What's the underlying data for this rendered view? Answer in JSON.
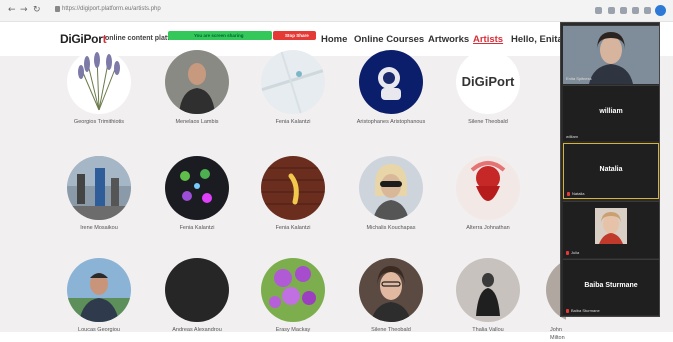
{
  "browser": {
    "url": "https://digiport.platform.eu/artists.php",
    "back_glyph": "←",
    "forward_glyph": "→",
    "reload_glyph": "↻"
  },
  "site": {
    "logo_prefix": "DiGiPor",
    "logo_suffix": "t",
    "tagline": "online content platform",
    "nav": [
      "Home",
      "Online Courses",
      "Artworks",
      "Artists",
      "Hello, Enita"
    ],
    "active_nav": "Artists"
  },
  "sharing": {
    "text": "You are screen sharing",
    "stop_label": "Stop Share"
  },
  "artists": [
    {
      "name": "Georgios Trimithiotis",
      "avatar": "lavender"
    },
    {
      "name": "Menelaos Lambis",
      "avatar": "man-portrait"
    },
    {
      "name": "Fenia Kalantzi",
      "avatar": "map"
    },
    {
      "name": "Aristophanes Aristophanous",
      "avatar": "astronaut"
    },
    {
      "name": "Silene Theobald",
      "avatar": "digiport-logo"
    },
    {
      "name": "Irene Mosaikou",
      "avatar": "street-scene"
    },
    {
      "name": "Fenia Kalantzi",
      "avatar": "lights"
    },
    {
      "name": "Fenia Kalantzi",
      "avatar": "banana"
    },
    {
      "name": "Michalis Kouchapas",
      "avatar": "woman-sunglasses"
    },
    {
      "name": "Alterra Johnathan",
      "avatar": "red-figure"
    },
    {
      "name": "Loucas Georgiou",
      "avatar": "man-outdoor"
    },
    {
      "name": "Andreas Alexandrou",
      "avatar": "dark"
    },
    {
      "name": "Erasy Mackay",
      "avatar": "flowers"
    },
    {
      "name": "Silene Theobald",
      "avatar": "woman-glasses"
    },
    {
      "name": "Thalia Vallou",
      "avatar": "figure-dark"
    },
    {
      "name": "John Milton",
      "avatar": "partial"
    }
  ],
  "meeting": {
    "participants": [
      {
        "name": "",
        "label": "Enita Spitness",
        "type": "video"
      },
      {
        "name": "william",
        "label": "william",
        "type": "name"
      },
      {
        "name": "Natalia",
        "label": "Natalia",
        "type": "name"
      },
      {
        "name": "",
        "label": "Julia",
        "type": "video"
      },
      {
        "name": "Baiba Sturmane",
        "label": "Baiba Sturmane",
        "type": "name"
      }
    ]
  },
  "colors": {
    "accent": "#d72f3a",
    "share_bar": "#34c759",
    "stop_button": "#e53935",
    "panel_bg": "#2b2b2b"
  }
}
